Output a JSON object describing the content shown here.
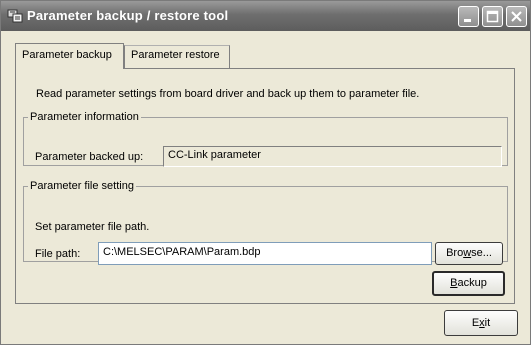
{
  "window": {
    "title": "Parameter backup / restore tool"
  },
  "tabs": [
    {
      "label": "Parameter backup",
      "active": true
    },
    {
      "label": "Parameter restore",
      "active": false
    }
  ],
  "panel": {
    "description": "Read parameter settings from board driver and back up them to parameter file.",
    "info_group": {
      "legend": "Parameter information",
      "backed_up_label": "Parameter backed up:",
      "backed_up_value": "CC-Link parameter"
    },
    "file_group": {
      "legend": "Parameter file setting",
      "instruction": "Set parameter file path.",
      "path_label": "File path:",
      "path_value": "C:\\MELSEC\\PARAM\\Param.bdp",
      "browse": {
        "pre": "Bro",
        "accel": "w",
        "post": "se..."
      }
    },
    "backup_button": {
      "accel": "B",
      "post": "ackup"
    }
  },
  "exit_button": {
    "pre": "E",
    "accel": "x",
    "post": "it"
  },
  "icons": {
    "app": "app-tool-icon",
    "minimize": "minimize-icon",
    "maximize": "maximize-icon",
    "close": "close-icon"
  }
}
